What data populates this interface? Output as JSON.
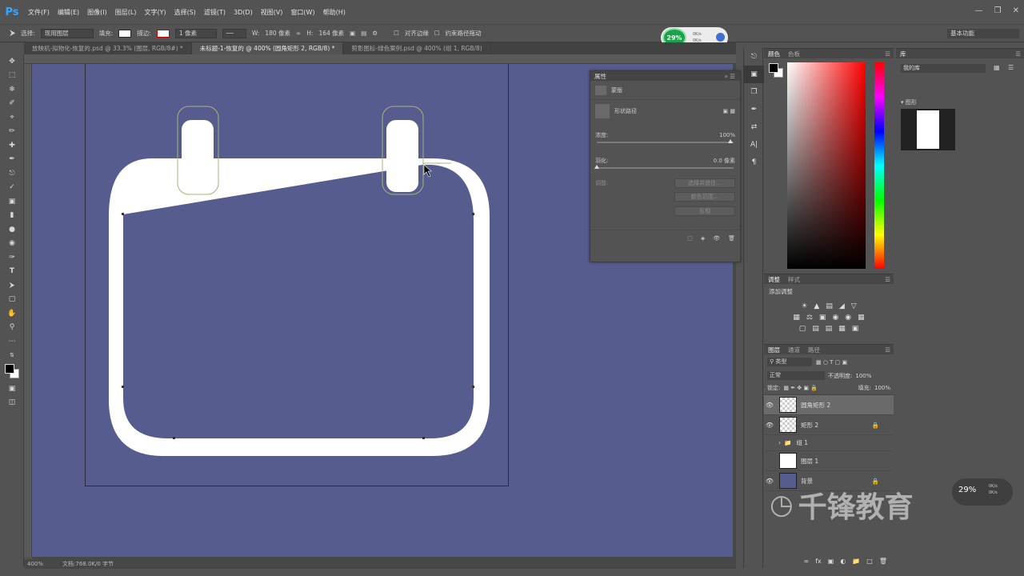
{
  "app": {
    "logo": "Ps"
  },
  "menu": [
    "文件(F)",
    "编辑(E)",
    "图像(I)",
    "图层(L)",
    "文字(Y)",
    "选择(S)",
    "滤镜(T)",
    "3D(D)",
    "视图(V)",
    "窗口(W)",
    "帮助(H)"
  ],
  "options": {
    "select_label": "选择:",
    "select_value": "现用图层",
    "fill_label": "填充:",
    "stroke_label": "描边:",
    "stroke_width": "1 像素",
    "w_label": "W:",
    "w_value": "180 像素",
    "h_label": "H:",
    "h_value": "164 像素",
    "align_edges": "对齐边缘",
    "constrain": "约束路径拖动",
    "workspace": "基本功能"
  },
  "perf": {
    "percent": "29%",
    "up": "0K/s",
    "down": "0K/s"
  },
  "tabs": [
    "放映机-拟物化-恢复的.psd @ 33.3% (图层, RGB/8#) *",
    "未标题-1-恢复的 @ 400% (圆角矩形 2, RGB/8) *",
    "剪影图标-绿色案例.psd @ 400% (组 1, RGB/8)"
  ],
  "properties": {
    "title": "属性",
    "mask_label": "蒙版",
    "vector_label": "形状路径",
    "density_label": "浓度:",
    "density_value": "100%",
    "feather_label": "羽化:",
    "feather_value": "0.0 像素",
    "adjust_label": "调整:",
    "btn_select": "选择并遮住...",
    "btn_color": "颜色范围...",
    "btn_invert": "反相"
  },
  "color_panel": {
    "tabs": [
      "颜色",
      "色板"
    ]
  },
  "library_panel": {
    "tab": "库",
    "selected": "我的库",
    "group": "图形"
  },
  "adjustments": {
    "tabs": [
      "调整",
      "样式"
    ],
    "add_label": "添加调整"
  },
  "layers_panel": {
    "tabs": [
      "图层",
      "通道",
      "路径"
    ],
    "kind": "类型",
    "blend": "正常",
    "opacity_label": "不透明度:",
    "opacity": "100%",
    "lock_label": "锁定:",
    "fill_label": "填充:",
    "fill": "100%",
    "layers": [
      {
        "name": "圆角矩形 2",
        "visible": true,
        "selected": true,
        "thumb": "checker"
      },
      {
        "name": "矩形 2",
        "visible": true,
        "selected": false,
        "thumb": "checker",
        "locked": true
      },
      {
        "name": "组 1",
        "visible": false,
        "selected": false,
        "thumb": "folder"
      },
      {
        "name": "图层 1",
        "visible": false,
        "selected": false,
        "thumb": "white"
      },
      {
        "name": "背景",
        "visible": true,
        "selected": false,
        "thumb": "blue",
        "locked": true
      }
    ]
  },
  "status": {
    "zoom": "400%",
    "doc": "文档:768.0K/0 字节"
  },
  "watermark": {
    "text": "千锋教育"
  },
  "colors": {
    "canvas_bg": "#575c8f",
    "shape": "#ffffff",
    "path": "#a6b37a",
    "ps_blue": "#31a8ff"
  }
}
